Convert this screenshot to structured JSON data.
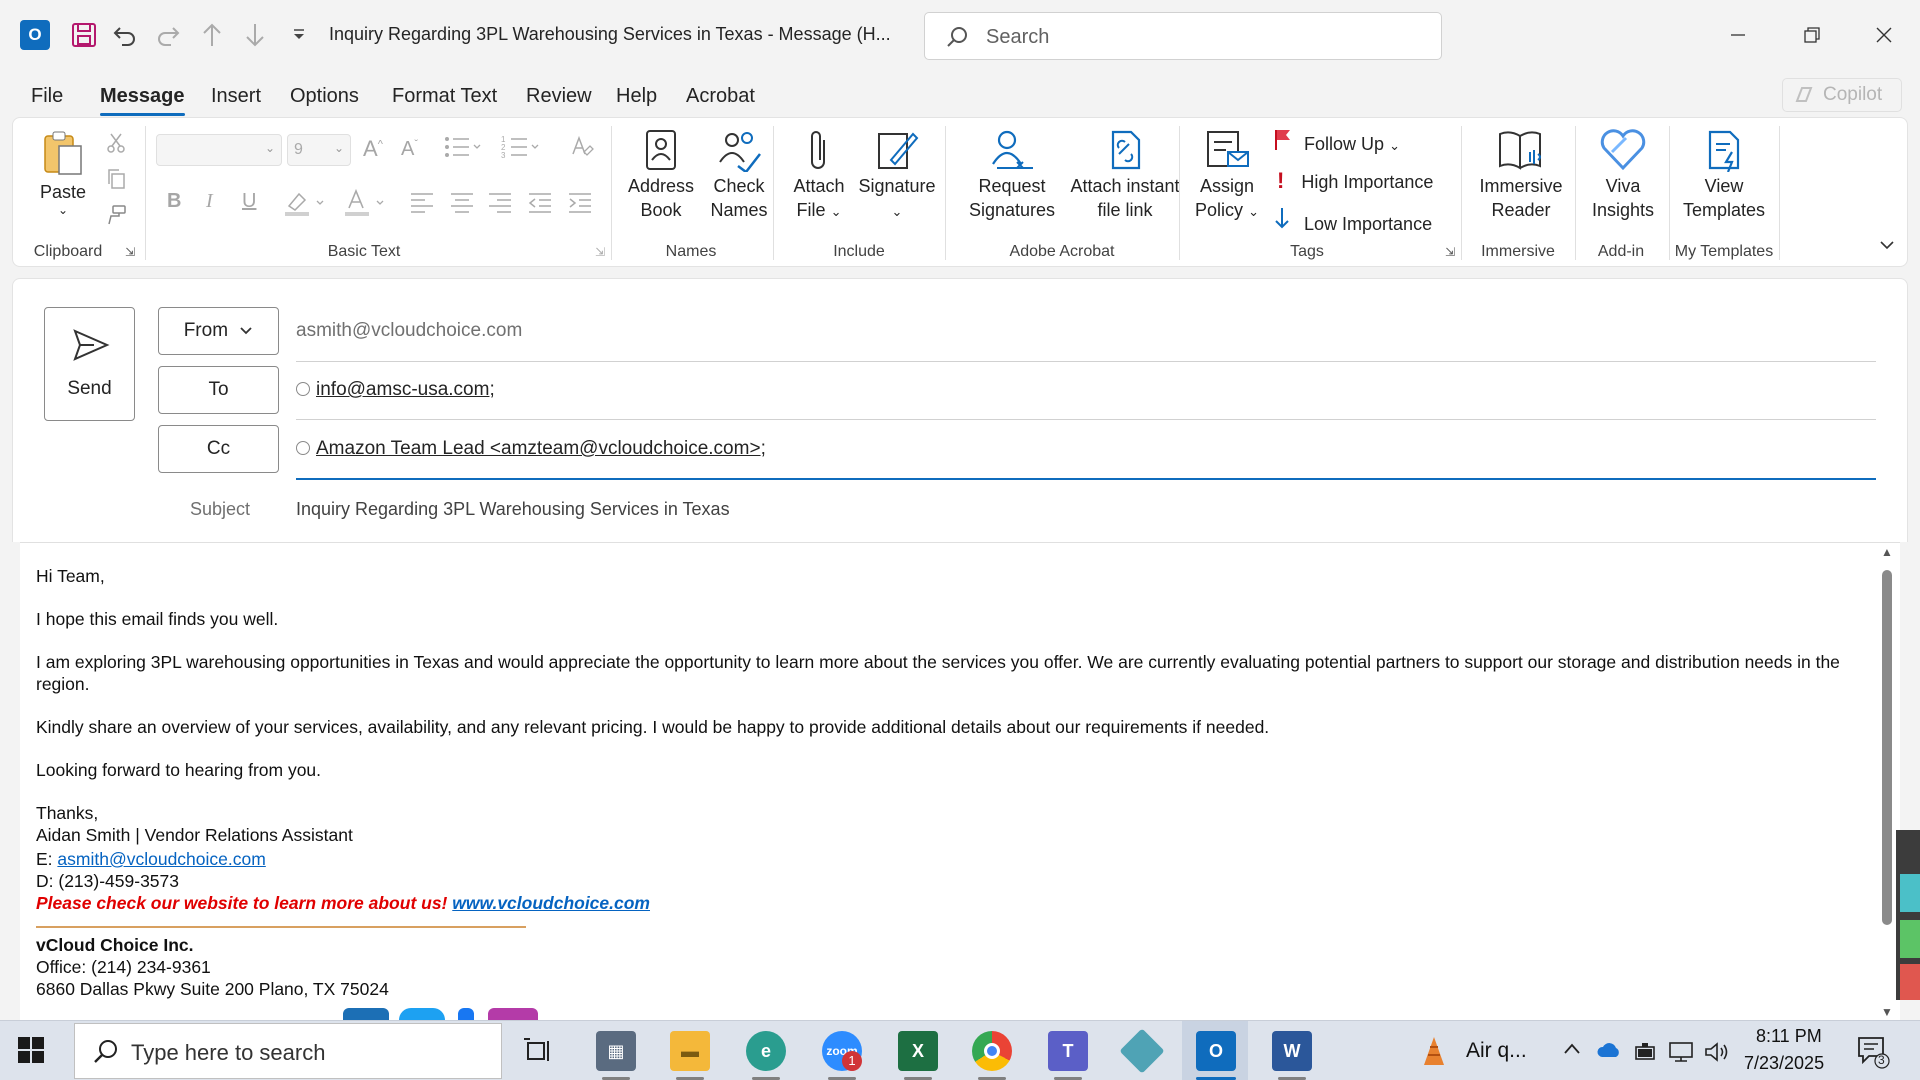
{
  "window": {
    "title": "Inquiry Regarding 3PL Warehousing Services in Texas  -  Message (H...",
    "search_placeholder": "Search"
  },
  "menu": {
    "tabs": [
      "File",
      "Message",
      "Insert",
      "Options",
      "Format Text",
      "Review",
      "Help",
      "Acrobat"
    ],
    "active": "Message",
    "copilot_label": "Copilot"
  },
  "ribbon": {
    "clipboard": {
      "paste": "Paste",
      "group": "Clipboard"
    },
    "basic_text": {
      "font_size": "9",
      "group": "Basic Text"
    },
    "names": {
      "address_book_1": "Address",
      "address_book_2": "Book",
      "check_names_1": "Check",
      "check_names_2": "Names",
      "group": "Names"
    },
    "include": {
      "attach_file_1": "Attach",
      "attach_file_2": "File",
      "signature": "Signature",
      "group": "Include"
    },
    "acrobat": {
      "request_sig_1": "Request",
      "request_sig_2": "Signatures",
      "attach_link_1": "Attach instant",
      "attach_link_2": "file link",
      "group": "Adobe Acrobat"
    },
    "tags": {
      "assign_policy_1": "Assign",
      "assign_policy_2": "Policy",
      "follow_up": "Follow Up",
      "high_importance": "High Importance",
      "low_importance": "Low Importance",
      "group": "Tags"
    },
    "immersive": {
      "reader_1": "Immersive",
      "reader_2": "Reader",
      "group": "Immersive"
    },
    "addin": {
      "viva_1": "Viva",
      "viva_2": "Insights",
      "group": "Add-in"
    },
    "templates": {
      "view_1": "View",
      "view_2": "Templates",
      "group": "My Templates"
    }
  },
  "compose": {
    "send_label": "Send",
    "from_label": "From",
    "from_value": "asmith@vcloudchoice.com",
    "to_label": "To",
    "to_value": "info@amsc-usa.com",
    "cc_label": "Cc",
    "cc_value": "Amazon Team Lead <amzteam@vcloudchoice.com>",
    "subject_label": "Subject",
    "subject_value": "Inquiry Regarding 3PL Warehousing Services in Texas"
  },
  "email_body": {
    "greeting": "Hi Team,",
    "p1": "I hope this email finds you well.",
    "p2": "I am exploring 3PL warehousing opportunities in Texas and would appreciate the opportunity to learn more about the services you offer. We are currently evaluating potential partners to support our storage and distribution needs in the region.",
    "p3": "Kindly share an overview of your services, availability, and any relevant pricing. I would be happy to provide additional details about our requirements if needed.",
    "p4": "Looking forward to hearing from you.",
    "closing": "Thanks,",
    "sig_name": "Aidan Smith | Vendor Relations Assistant",
    "sig_email_prefix": "E: ",
    "sig_email": "asmith@vcloudchoice.com",
    "sig_direct": "D: (213)-459-3573",
    "promo_text": "Please check our website to learn more about us!",
    "promo_link": "www.vcloudchoice.com",
    "company": "vCloud Choice Inc.",
    "office": "Office: (214) 234-9361",
    "address": "6860 Dallas Pkwy Suite 200 Plano, TX 75024"
  },
  "taskbar": {
    "search_placeholder": "Type here to search",
    "weather": "Air q...",
    "time": "8:11 PM",
    "date": "7/23/2025",
    "notification_count": "3",
    "zoom_badge": "1"
  },
  "colors": {
    "accent": "#0f6cbd",
    "promo_red": "#e00000",
    "link_blue": "#0563c1"
  }
}
